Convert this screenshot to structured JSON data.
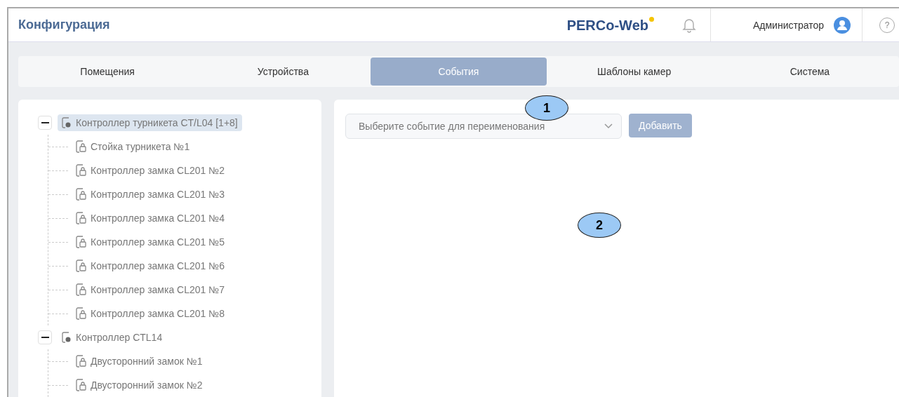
{
  "header": {
    "title": "Конфигурация",
    "logo": "PERCo-Web",
    "user": "Администратор",
    "help": "?"
  },
  "tabs": [
    {
      "label": "Помещения",
      "selected": false
    },
    {
      "label": "Устройства",
      "selected": false
    },
    {
      "label": "События",
      "selected": true
    },
    {
      "label": "Шаблоны камер",
      "selected": false
    },
    {
      "label": "Система",
      "selected": false
    }
  ],
  "tree": [
    {
      "label": "Контроллер турникета CT/L04 [1+8]",
      "selected": true,
      "expanded": true,
      "children": [
        {
          "label": "Стойка турникета №1",
          "selected": false
        },
        {
          "label": "Контроллер замка CL201 №2",
          "selected": false
        },
        {
          "label": "Контроллер замка CL201 №3",
          "selected": false
        },
        {
          "label": "Контроллер замка CL201 №4",
          "selected": false
        },
        {
          "label": "Контроллер замка CL201 №5",
          "selected": false
        },
        {
          "label": "Контроллер замка CL201 №6",
          "selected": false
        },
        {
          "label": "Контроллер замка CL201 №7",
          "selected": false
        },
        {
          "label": "Контроллер замка CL201 №8",
          "selected": false
        }
      ]
    },
    {
      "label": "Контроллер CTL14",
      "selected": false,
      "expanded": true,
      "children": [
        {
          "label": "Двусторонний замок №1",
          "selected": false
        },
        {
          "label": "Двусторонний замок №2",
          "selected": false
        }
      ]
    }
  ],
  "event_select": {
    "placeholder": "Выберите событие для переименования"
  },
  "add_button": {
    "label": "Добавить",
    "disabled": true
  },
  "callouts": [
    "1",
    "2"
  ]
}
